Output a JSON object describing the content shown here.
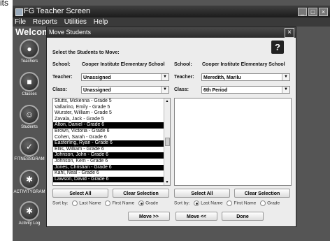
{
  "top_fragment": "its",
  "window": {
    "title": "FG Teacher Screen",
    "minimize": "_",
    "maximize": "□",
    "close": "×"
  },
  "menu": [
    "File",
    "Reports",
    "Utilities",
    "Help"
  ],
  "welcome": "Welcom",
  "sidebar": [
    {
      "label": "Teachers",
      "icon": "teacher-icon"
    },
    {
      "label": "Classes",
      "icon": "classes-icon"
    },
    {
      "label": "Students",
      "icon": "students-icon"
    },
    {
      "label": "FITNESSGRAM",
      "icon": "fitnessgram-icon"
    },
    {
      "label": "ACTIVITYGRAM",
      "icon": "activitygram-icon"
    },
    {
      "label": "Activity Log",
      "icon": "activity-log-icon"
    }
  ],
  "dialog": {
    "title": "Move Students",
    "close": "×",
    "help": "?",
    "instruction": "Select the Students to Move:",
    "left": {
      "school_label": "School:",
      "school": "Cooper Institute Elementary School",
      "teacher_label": "Teacher:",
      "teacher": "Unassigned",
      "class_label": "Class:",
      "class": "Unassigned",
      "students": [
        {
          "name": "Stutts, Mckenna - Grade 5",
          "selected": false
        },
        {
          "name": "Vallarino, Emily - Grade 5",
          "selected": false
        },
        {
          "name": "Wurster, William - Grade 5",
          "selected": false
        },
        {
          "name": "Zavala, Jack - Grade 5",
          "selected": false
        },
        {
          "name": "Alton, Daniel - Grade 6",
          "selected": true
        },
        {
          "name": "Brown, Victoria - Grade 6",
          "selected": false
        },
        {
          "name": "Cohen, Sarah - Grade 6",
          "selected": false
        },
        {
          "name": "Easterling, Ryan - Grade 6",
          "selected": true
        },
        {
          "name": "Ellis, William - Grade 6",
          "selected": false
        },
        {
          "name": "Johnson, John - Grade 6",
          "selected": true
        },
        {
          "name": "Johnson, Kem - Grade 6",
          "selected": false
        },
        {
          "name": "Jones, Christian - Grade 6",
          "selected": true
        },
        {
          "name": "Kahl, Neal - Grade 6",
          "selected": false
        },
        {
          "name": "Lawson, David - Grade 6",
          "selected": true
        }
      ],
      "select_all": "Select All",
      "clear_selection": "Clear Selection",
      "sort_by": "Sort by:",
      "sort_options": [
        "Last Name",
        "First Name",
        "Grade"
      ],
      "sort_selected": "Grade"
    },
    "right": {
      "school_label": "School:",
      "school": "Cooper Institute Elementary School",
      "teacher_label": "Teacher:",
      "teacher": "Meredith, Marilu",
      "class_label": "Class:",
      "class": "6th Period",
      "students": [],
      "select_all": "Select All",
      "clear_selection": "Clear Selection",
      "sort_by": "Sort by:",
      "sort_options": [
        "Last Name",
        "First Name",
        "Grade"
      ],
      "sort_selected": "Last Name"
    },
    "move_right": "Move >>",
    "move_left": "Move <<",
    "done": "Done"
  }
}
